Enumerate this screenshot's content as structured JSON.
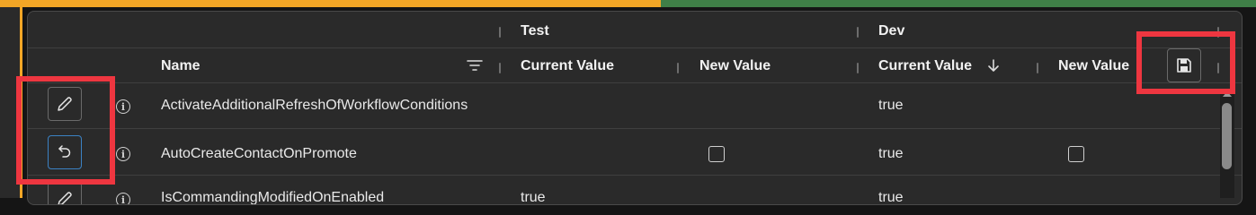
{
  "theme": {
    "accent_orange": "#f2a626",
    "accent_green": "#3f7f47",
    "highlight_red": "#ee3640",
    "focus_blue": "#3b82c4"
  },
  "groups": {
    "test": "Test",
    "dev": "Dev"
  },
  "columns": {
    "name": "Name",
    "test_current": "Current Value",
    "test_new": "New Value",
    "dev_current": "Current Value",
    "dev_new": "New Value"
  },
  "rows": [
    {
      "name": "ActivateAdditionalRefreshOfWorkflowConditions",
      "test_current": "",
      "test_new_checkbox": false,
      "dev_current": "true",
      "dev_new_checkbox": false,
      "action": "edit"
    },
    {
      "name": "AutoCreateContactOnPromote",
      "test_current": "",
      "test_new_checkbox": true,
      "dev_current": "true",
      "dev_new_checkbox": true,
      "action": "undo"
    },
    {
      "name": "IsCommandingModifiedOnEnabled",
      "test_current": "true",
      "dev_current": "true",
      "action": "edit"
    }
  ],
  "icons": {
    "filter": "filter-icon",
    "sort": "sort-descending-icon",
    "save": "save-icon",
    "edit": "pencil-icon",
    "undo": "undo-icon",
    "info": "info-icon"
  }
}
